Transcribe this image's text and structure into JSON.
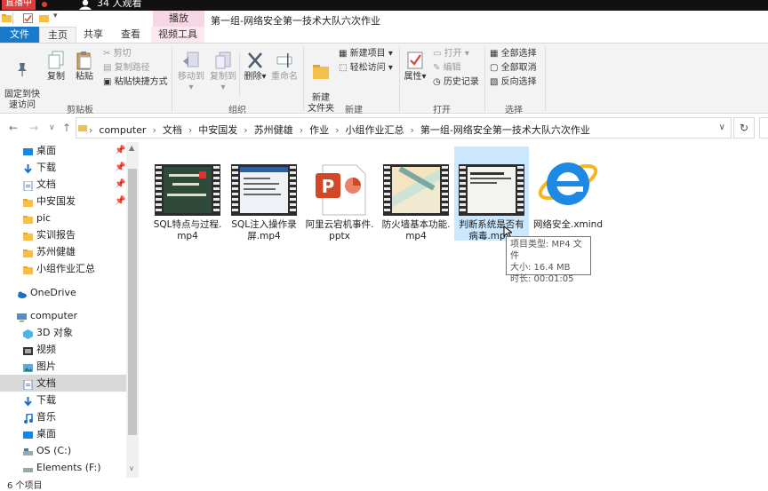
{
  "live": {
    "badge": "直播中",
    "viewers": "34 人观看"
  },
  "title": {
    "context_tab": "播放",
    "window_title": "第一组-网络安全第一技术大队六次作业"
  },
  "tabs": {
    "file": "文件",
    "home": "主页",
    "share": "共享",
    "view": "查看",
    "video_tools": "视频工具"
  },
  "ribbon": {
    "clipboard": {
      "pin_quick": "固定到快\n速访问",
      "copy": "复制",
      "paste": "粘贴",
      "cut": "剪切",
      "copy_path": "复制路径",
      "paste_shortcut": "粘贴快捷方式",
      "label": "剪贴板"
    },
    "organize": {
      "move_to": "移动到",
      "copy_to": "复制到",
      "delete": "删除",
      "rename": "重命名",
      "label": "组织"
    },
    "new": {
      "new_folder": "新建\n文件夹",
      "new_item": "新建项目",
      "easy_access": "轻松访问",
      "label": "新建"
    },
    "open": {
      "properties": "属性",
      "open": "打开",
      "edit": "编辑",
      "history": "历史记录",
      "label": "打开"
    },
    "select": {
      "select_all": "全部选择",
      "select_none": "全部取消",
      "invert": "反向选择",
      "label": "选择"
    }
  },
  "address": {
    "crumbs": [
      "computer",
      "文档",
      "中安国发",
      "苏州健雄",
      "作业",
      "小组作业汇总",
      "第一组-网络安全第一技术大队六次作业"
    ]
  },
  "nav": {
    "quick": [
      {
        "label": "桌面",
        "pinned": "📌"
      },
      {
        "label": "下载",
        "pinned": "📌"
      },
      {
        "label": "文档",
        "pinned": "📌"
      },
      {
        "label": "中安国发",
        "pinned": "📌"
      },
      {
        "label": "pic",
        "pinned": ""
      },
      {
        "label": "实训报告",
        "pinned": ""
      },
      {
        "label": "苏州健雄",
        "pinned": ""
      },
      {
        "label": "小组作业汇总",
        "pinned": ""
      }
    ],
    "onedrive": "OneDrive",
    "computer": "computer",
    "computer_items": [
      "3D 对象",
      "视频",
      "图片",
      "文档",
      "下载",
      "音乐",
      "桌面",
      "OS (C:)",
      "Elements (F:)"
    ]
  },
  "files": [
    {
      "name": "SQL特点与过程.\nmp4"
    },
    {
      "name": "SQL注入操作录\n屏.mp4"
    },
    {
      "name": "阿里云宕机事件.\npptx"
    },
    {
      "name": "防火墙基本功能.\nmp4"
    },
    {
      "name": "判断系统是否有\n病毒.mp..."
    },
    {
      "name": "网络安全.xmind"
    }
  ],
  "tooltip": {
    "type": "项目类型: MP4 文件",
    "size": "大小: 16.4 MB",
    "duration": "时长: 00:01:05"
  },
  "status": {
    "count": "6 个项目"
  },
  "colors": {
    "file_tab": "#1979ca",
    "selection": "#cce8ff",
    "context_tab": "#f6d6e3",
    "live_red": "#e23b3b"
  }
}
